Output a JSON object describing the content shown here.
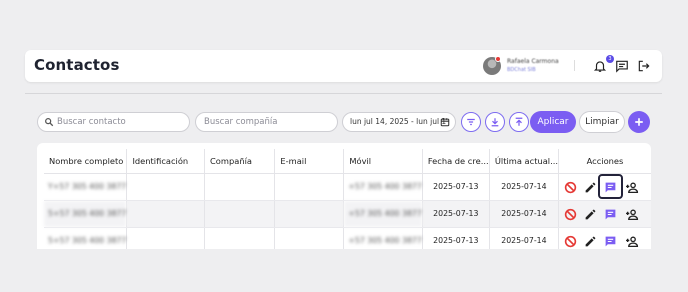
{
  "header": {
    "title": "Contactos",
    "user_name": "Rafaela Carmona",
    "user_sub": "BDChat SIB",
    "notification_count": "3"
  },
  "filters": {
    "search_contact_placeholder": "Buscar contacto",
    "search_company_placeholder": "Buscar compañía",
    "date_range": "lun jul 14, 2025 - lun jul 1",
    "apply_label": "Aplicar",
    "clear_label": "Limpiar"
  },
  "table": {
    "columns": [
      "Nombre completo",
      "Identificación",
      "Compañía",
      "E-mail",
      "Móvil",
      "Fecha de cre...",
      "Última actual...",
      "Acciones"
    ],
    "rows": [
      {
        "name": "Y+57 305 400 3877",
        "id": "",
        "company": "",
        "email": "",
        "mobile": "+57 305 400 3877",
        "created": "2025-07-13",
        "updated": "2025-07-14"
      },
      {
        "name": "5+57 305 400 3877",
        "id": "",
        "company": "",
        "email": "",
        "mobile": "+57 305 400 3877",
        "created": "2025-07-13",
        "updated": "2025-07-14"
      },
      {
        "name": "5+57 305 400 3877",
        "id": "",
        "company": "",
        "email": "",
        "mobile": "+57 305 400 3877",
        "created": "2025-07-13",
        "updated": "2025-07-14"
      }
    ]
  },
  "colors": {
    "accent": "#7b5df2",
    "danger": "#e53935",
    "highlight_border": "#23233a"
  },
  "icons": [
    "bell-icon",
    "chat-icon",
    "logout-icon",
    "search-icon",
    "calendar-icon",
    "filter-icon",
    "download-icon",
    "upload-icon",
    "plus-icon",
    "block-icon",
    "edit-icon",
    "message-icon",
    "add-person-icon"
  ]
}
